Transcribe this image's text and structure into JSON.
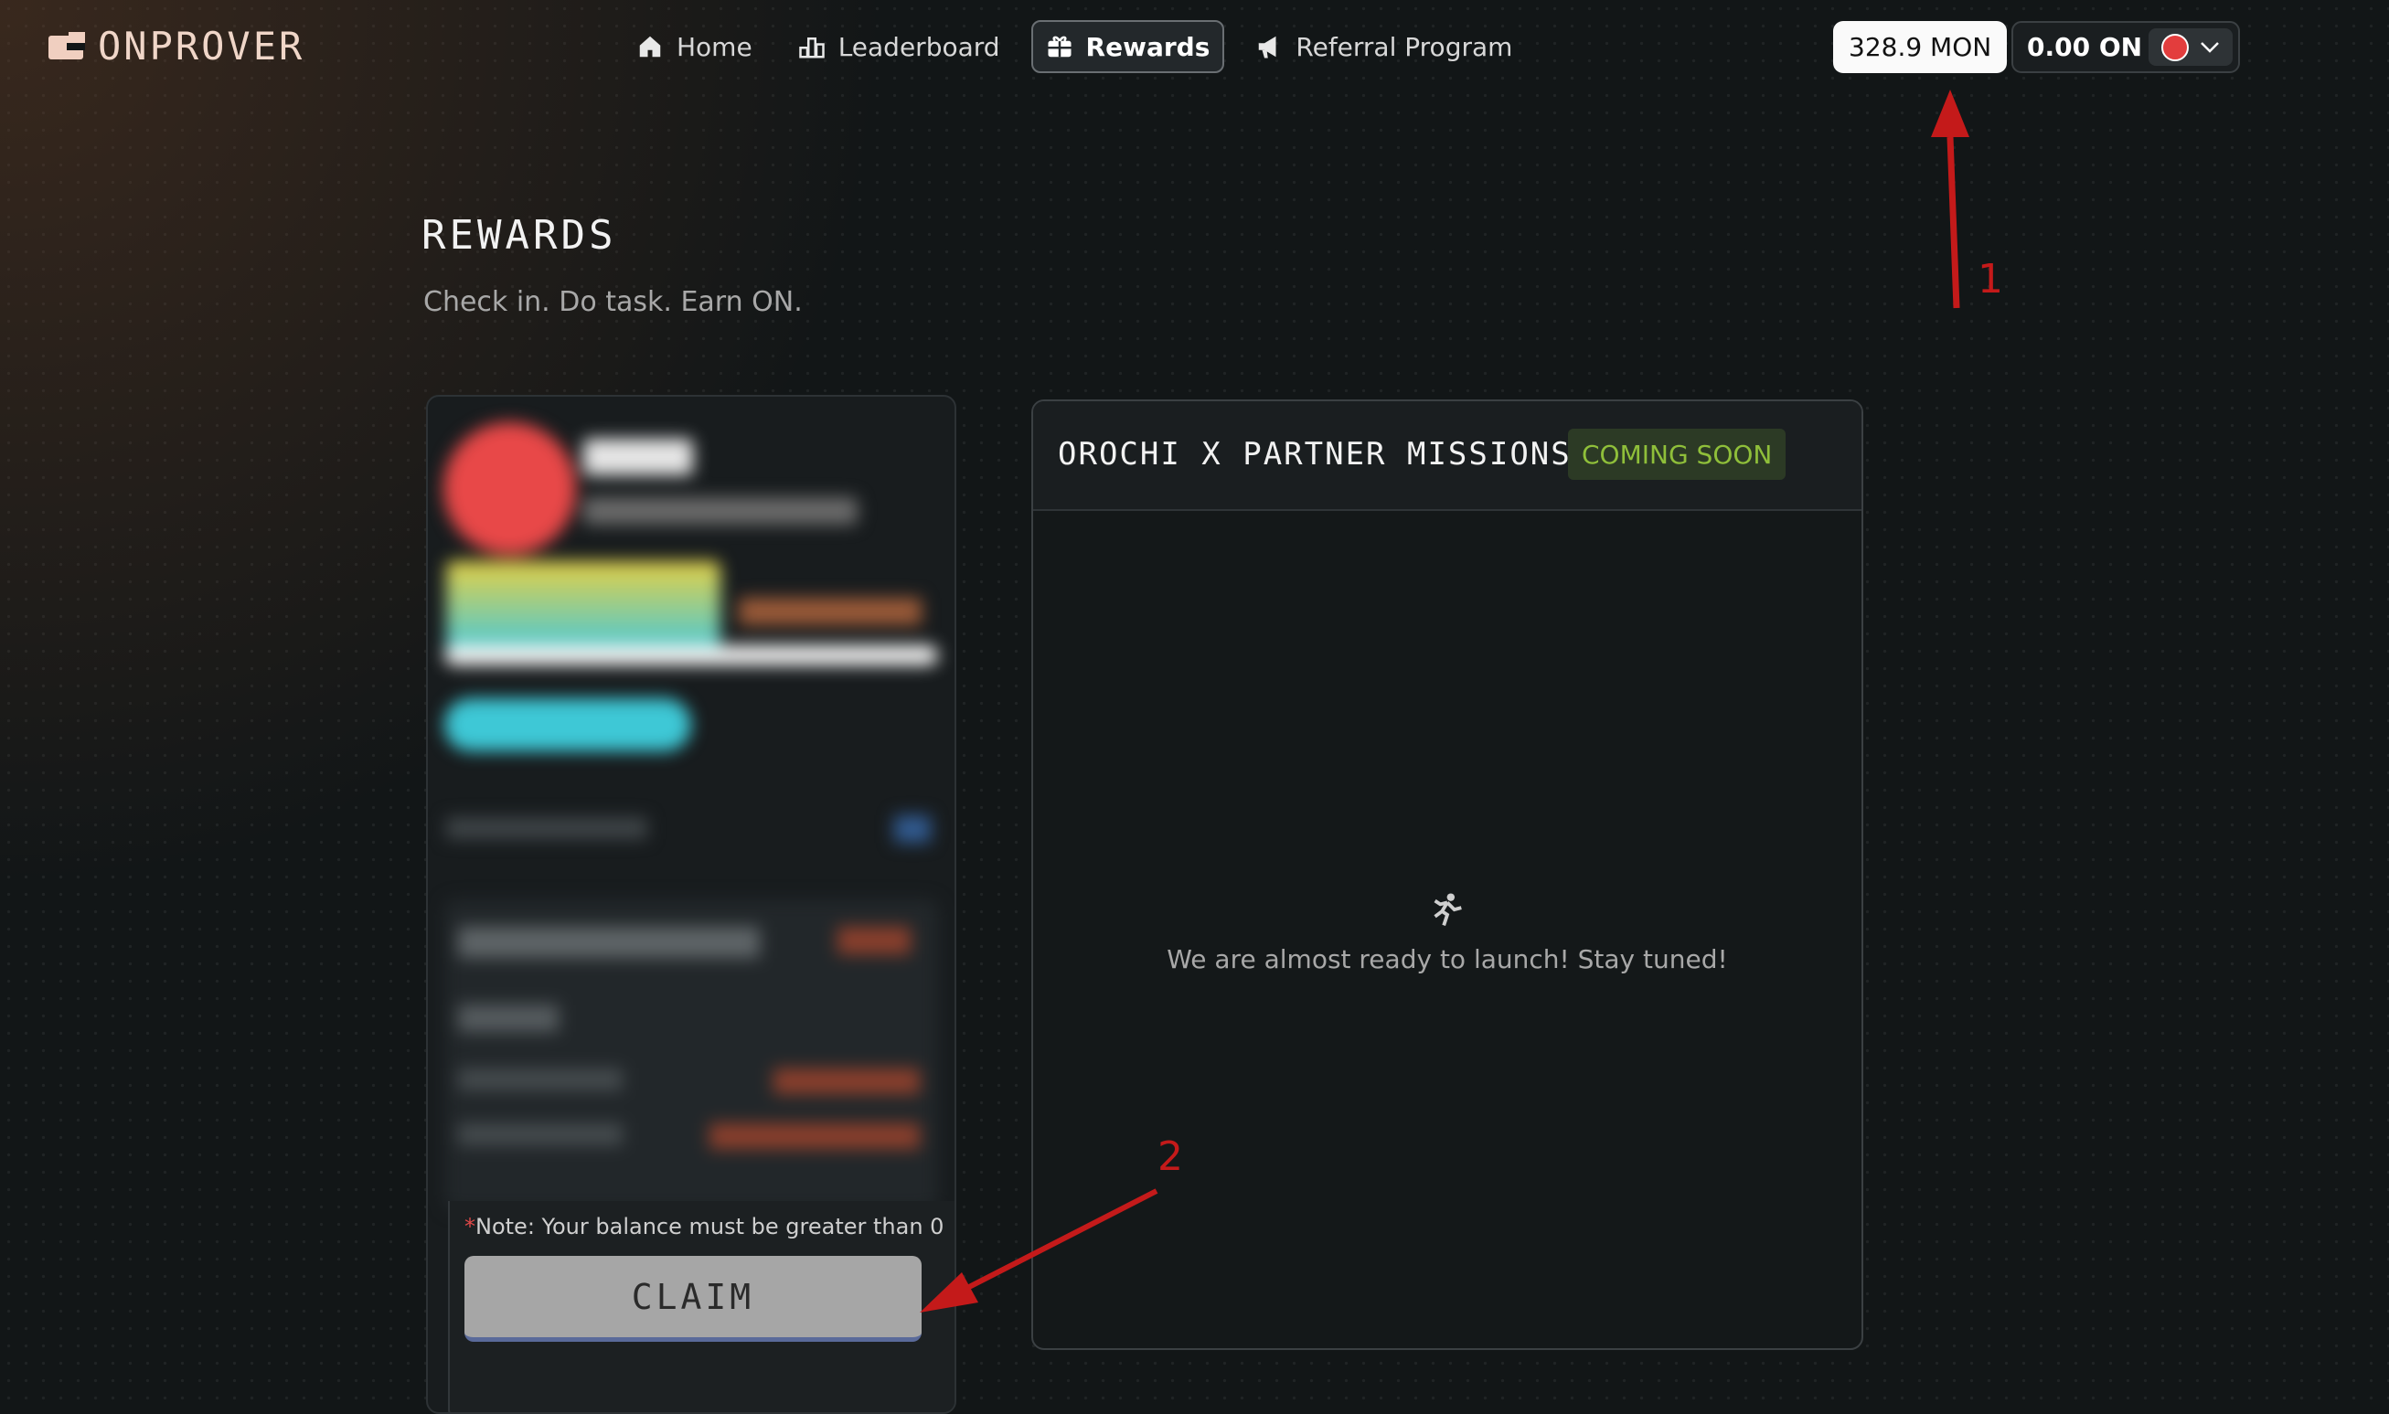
{
  "header": {
    "logo_text": "ONPROVER",
    "nav": [
      {
        "label": "Home",
        "icon": "home-icon",
        "active": false
      },
      {
        "label": "Leaderboard",
        "icon": "leaderboard-icon",
        "active": false
      },
      {
        "label": "Rewards",
        "icon": "gift-icon",
        "active": true
      },
      {
        "label": "Referral Program",
        "icon": "megaphone-icon",
        "active": false
      }
    ],
    "mon_balance": "328.9 MON",
    "on_balance": "0.00 ON"
  },
  "page": {
    "title": "REWARDS",
    "subtitle": "Check in. Do task. Earn ON."
  },
  "profile_card": {
    "note_star": "*",
    "note": "Note: Your balance must be greater than 0",
    "claim_label": "CLAIM"
  },
  "missions": {
    "title": "OROCHI X PARTNER MISSIONS",
    "badge": "COMING SOON",
    "empty_message": "We are almost ready to launch! Stay tuned!"
  },
  "annotations": {
    "label_1": "1",
    "label_2": "2",
    "color": "#c41a1a"
  },
  "colors": {
    "background": "#121617",
    "accent_green": "#8fbf3a",
    "avatar_red": "#e33d3d"
  }
}
